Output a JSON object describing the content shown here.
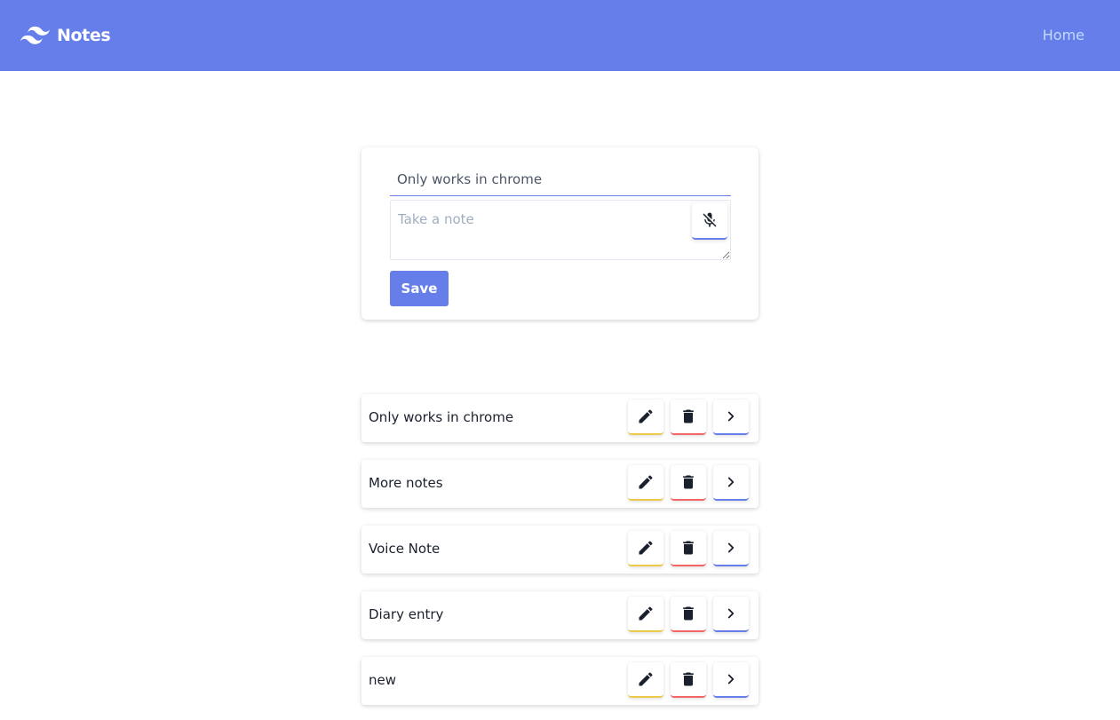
{
  "navbar": {
    "brand": "Notes",
    "logo_icon": "tailwind-wave-icon",
    "home_link": "Home",
    "background": "#667eea"
  },
  "form": {
    "title_value": "Only works in chrome",
    "note_placeholder": "Take a note",
    "mic_icon": "microphone-off-icon",
    "save_label": "Save"
  },
  "notes": [
    {
      "title": "Only works in chrome"
    },
    {
      "title": "More notes"
    },
    {
      "title": "Voice Note"
    },
    {
      "title": "Diary entry"
    },
    {
      "title": "new"
    }
  ],
  "note_actions": {
    "edit_icon": "pencil-icon",
    "delete_icon": "trash-icon",
    "open_icon": "chevron-right-icon",
    "edit_color": "#ecc94b",
    "delete_color": "#f56565",
    "open_color": "#667eea"
  }
}
